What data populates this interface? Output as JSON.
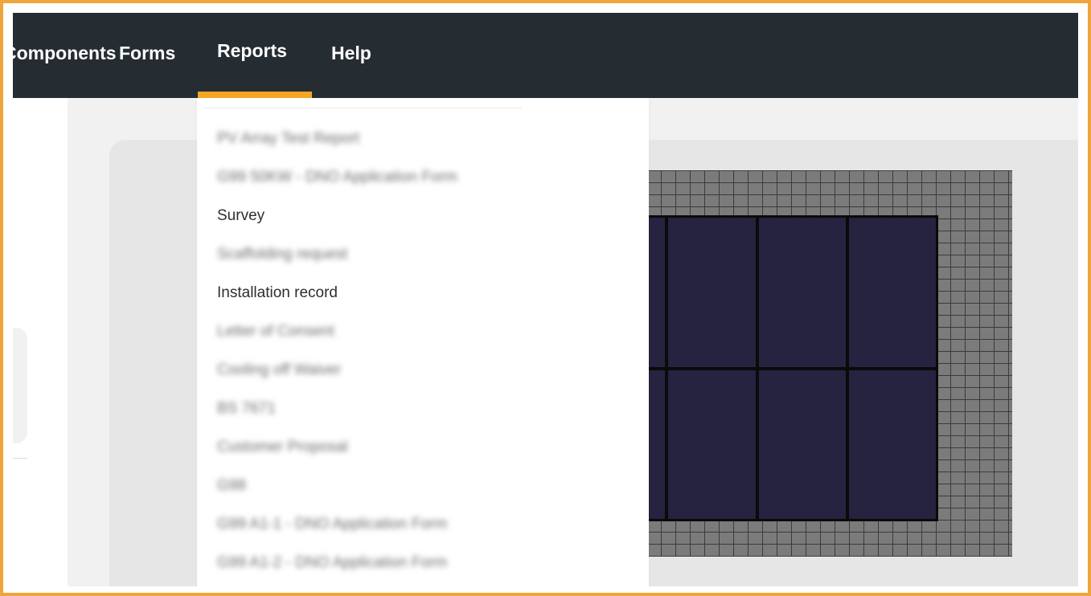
{
  "navbar": {
    "items": [
      {
        "label": "Components"
      },
      {
        "label": "Forms"
      },
      {
        "label": "Reports"
      },
      {
        "label": "Help"
      }
    ],
    "active": "Reports",
    "accent_color": "#f5a623",
    "background_color": "#252d33"
  },
  "reports_menu": {
    "items": [
      {
        "label": "PV Array Test Report",
        "blurred": true
      },
      {
        "label": "G99 50KW - DNO Application Form",
        "blurred": true
      },
      {
        "label": "Survey",
        "blurred": false
      },
      {
        "label": "Scaffolding request",
        "blurred": true
      },
      {
        "label": "Installation record",
        "blurred": false
      },
      {
        "label": "Letter of Consent",
        "blurred": true
      },
      {
        "label": "Cooling off Waiver",
        "blurred": true
      },
      {
        "label": "BS 7671",
        "blurred": true
      },
      {
        "label": "Customer Proposal",
        "blurred": true
      },
      {
        "label": "G98",
        "blurred": true
      },
      {
        "label": "G99 A1-1 - DNO Application Form",
        "blurred": true
      },
      {
        "label": "G99 A1-2 - DNO Application Form",
        "blurred": true
      }
    ]
  },
  "design_canvas": {
    "roof_color": "#7b7b7b",
    "panel_color": "#25233f",
    "panel_rows": 2,
    "panel_columns": 4
  }
}
